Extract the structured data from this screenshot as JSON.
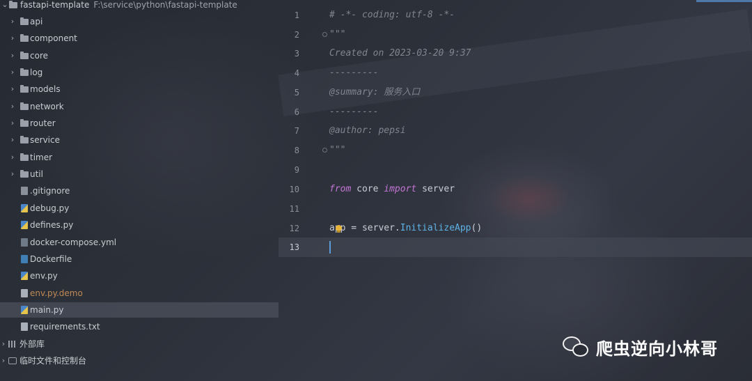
{
  "project": {
    "root_name": "fastapi-template",
    "root_path": "F:\\service\\python\\fastapi-template",
    "folders": [
      {
        "label": "api"
      },
      {
        "label": "component"
      },
      {
        "label": "core"
      },
      {
        "label": "log"
      },
      {
        "label": "models"
      },
      {
        "label": "network"
      },
      {
        "label": "router"
      },
      {
        "label": "service"
      },
      {
        "label": "timer"
      },
      {
        "label": "util"
      }
    ],
    "files": [
      {
        "label": ".gitignore",
        "icon": "git-file-icon"
      },
      {
        "label": "debug.py",
        "icon": "python-file-icon"
      },
      {
        "label": "defines.py",
        "icon": "python-file-icon"
      },
      {
        "label": "docker-compose.yml",
        "icon": "yaml-file-icon"
      },
      {
        "label": "Dockerfile",
        "icon": "docker-file-icon"
      },
      {
        "label": "env.py",
        "icon": "python-file-icon"
      },
      {
        "label": "env.py.demo",
        "icon": "text-file-icon"
      },
      {
        "label": "main.py",
        "icon": "python-file-icon"
      },
      {
        "label": "requirements.txt",
        "icon": "text-file-icon"
      }
    ],
    "external_libs": "外部库",
    "scratches": "临时文件和控制台",
    "selected_file": "main.py"
  },
  "editor": {
    "lines": [
      {
        "n": "1",
        "text": "# -*- coding: utf-8 -*-"
      },
      {
        "n": "2",
        "text": "\"\"\""
      },
      {
        "n": "3",
        "text": "Created on 2023-03-20 9:37"
      },
      {
        "n": "4",
        "text": "---------"
      },
      {
        "n": "5",
        "text": "@summary: 服务入口"
      },
      {
        "n": "6",
        "text": "---------"
      },
      {
        "n": "7",
        "text": "@author: pepsi"
      },
      {
        "n": "8",
        "text": "\"\"\""
      },
      {
        "n": "9",
        "text": ""
      },
      {
        "n": "10",
        "kw1": "from",
        "mod": " core ",
        "kw2": "import",
        "name": " server"
      },
      {
        "n": "11",
        "text": ""
      },
      {
        "n": "12",
        "pre": "app = server.",
        "fn": "InitializeApp",
        "post": "()"
      },
      {
        "n": "13",
        "text": ""
      }
    ],
    "current_line": "13"
  },
  "watermark": {
    "text": "爬虫逆向小林哥",
    "icon": "wechat-icon"
  },
  "colors": {
    "keyword": "#c476d6",
    "function": "#5eb3e6",
    "comment": "#7e8690",
    "caret": "#5b9bd8",
    "warning_file": "#c08a55"
  }
}
